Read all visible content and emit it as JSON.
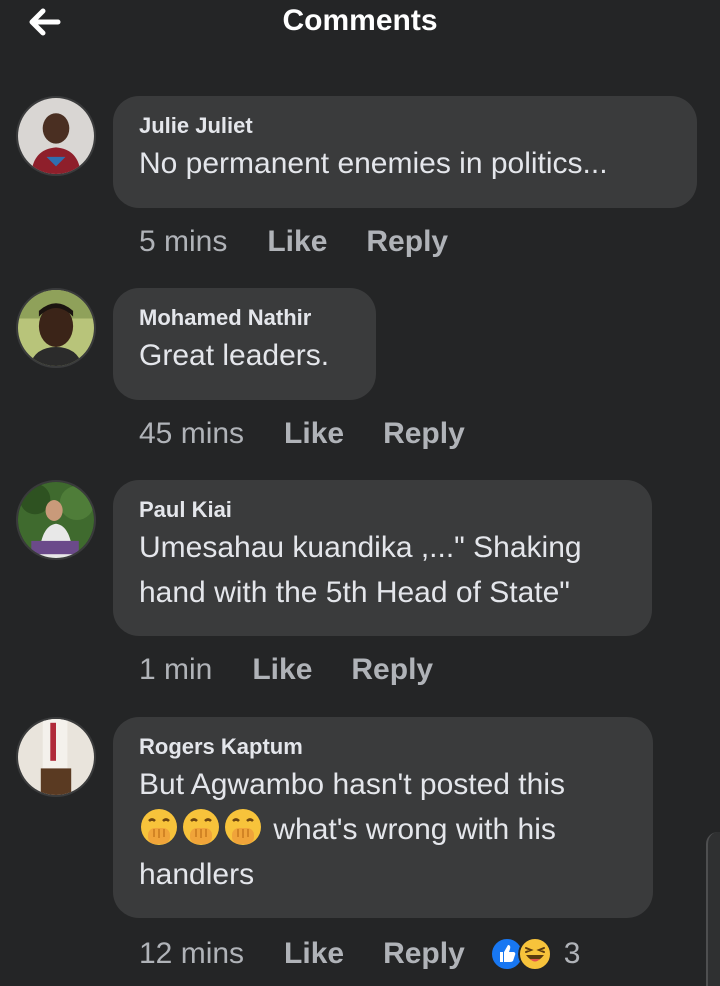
{
  "header": {
    "title": "Comments",
    "back_icon": "arrow-left-icon"
  },
  "colors": {
    "background": "#242526",
    "bubble": "#3a3b3c",
    "primary_text": "#e4e6eb",
    "secondary_text": "#b0b3b8",
    "like_blue": "#1877f2"
  },
  "comments": [
    {
      "author": "Julie Juliet",
      "lines": [
        "No permanent enemies in politics..."
      ],
      "time": "5 mins",
      "like": "Like",
      "reply": "Reply"
    },
    {
      "author": "Mohamed Nathir",
      "lines": [
        "Great leaders."
      ],
      "time": "45 mins",
      "like": "Like",
      "reply": "Reply"
    },
    {
      "author": "Paul Kiai",
      "lines": [
        "Umesahau kuandika ,...\" Shaking",
        "hand with the 5th Head of State\""
      ],
      "time": "1 min",
      "like": "Like",
      "reply": "Reply"
    },
    {
      "author": "Rogers Kaptum",
      "lines": [
        "But Agwambo hasn't posted this",
        "what's wrong with his",
        "handlers"
      ],
      "emojis": [
        "face-with-hand-over-mouth-emoji",
        "face-with-hand-over-mouth-emoji",
        "face-with-hand-over-mouth-emoji"
      ],
      "time": "12 mins",
      "like": "Like",
      "reply": "Reply",
      "reactions": [
        "like-reaction-icon",
        "haha-reaction-icon"
      ],
      "reaction_count": "3"
    }
  ]
}
